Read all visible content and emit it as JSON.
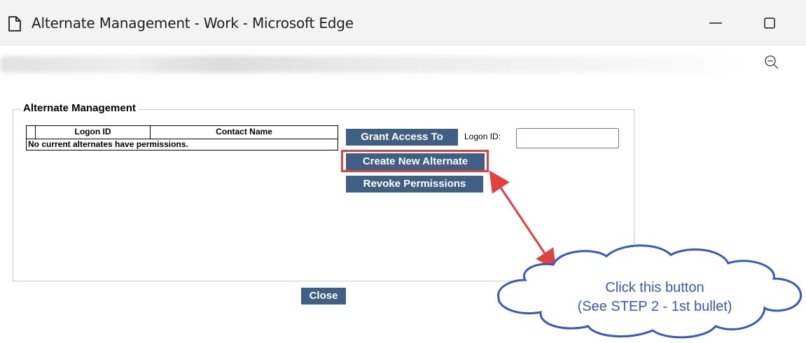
{
  "window": {
    "title": "Alternate Management - Work - Microsoft Edge",
    "page_icon": "page-icon",
    "minimize_icon": "minimize-icon",
    "maximize_icon": "maximize-icon",
    "zoom_icon": "zoom-out-icon"
  },
  "panel": {
    "legend": "Alternate Management",
    "table": {
      "columns": [
        "Logon ID",
        "Contact Name"
      ],
      "empty_message": "No current alternates have permissions."
    },
    "buttons": {
      "grant_access": "Grant Access To",
      "create_new": "Create New Alternate",
      "revoke": "Revoke Permissions"
    },
    "logon_label": "Logon ID:",
    "logon_value": ""
  },
  "footer": {
    "close_label": "Close"
  },
  "callout": {
    "line1": "Click this button",
    "line2": "(See STEP 2 - 1st bullet)"
  },
  "colors": {
    "button_bg": "#3f5f85",
    "highlight": "#e0433f",
    "callout": "#3557c8"
  }
}
